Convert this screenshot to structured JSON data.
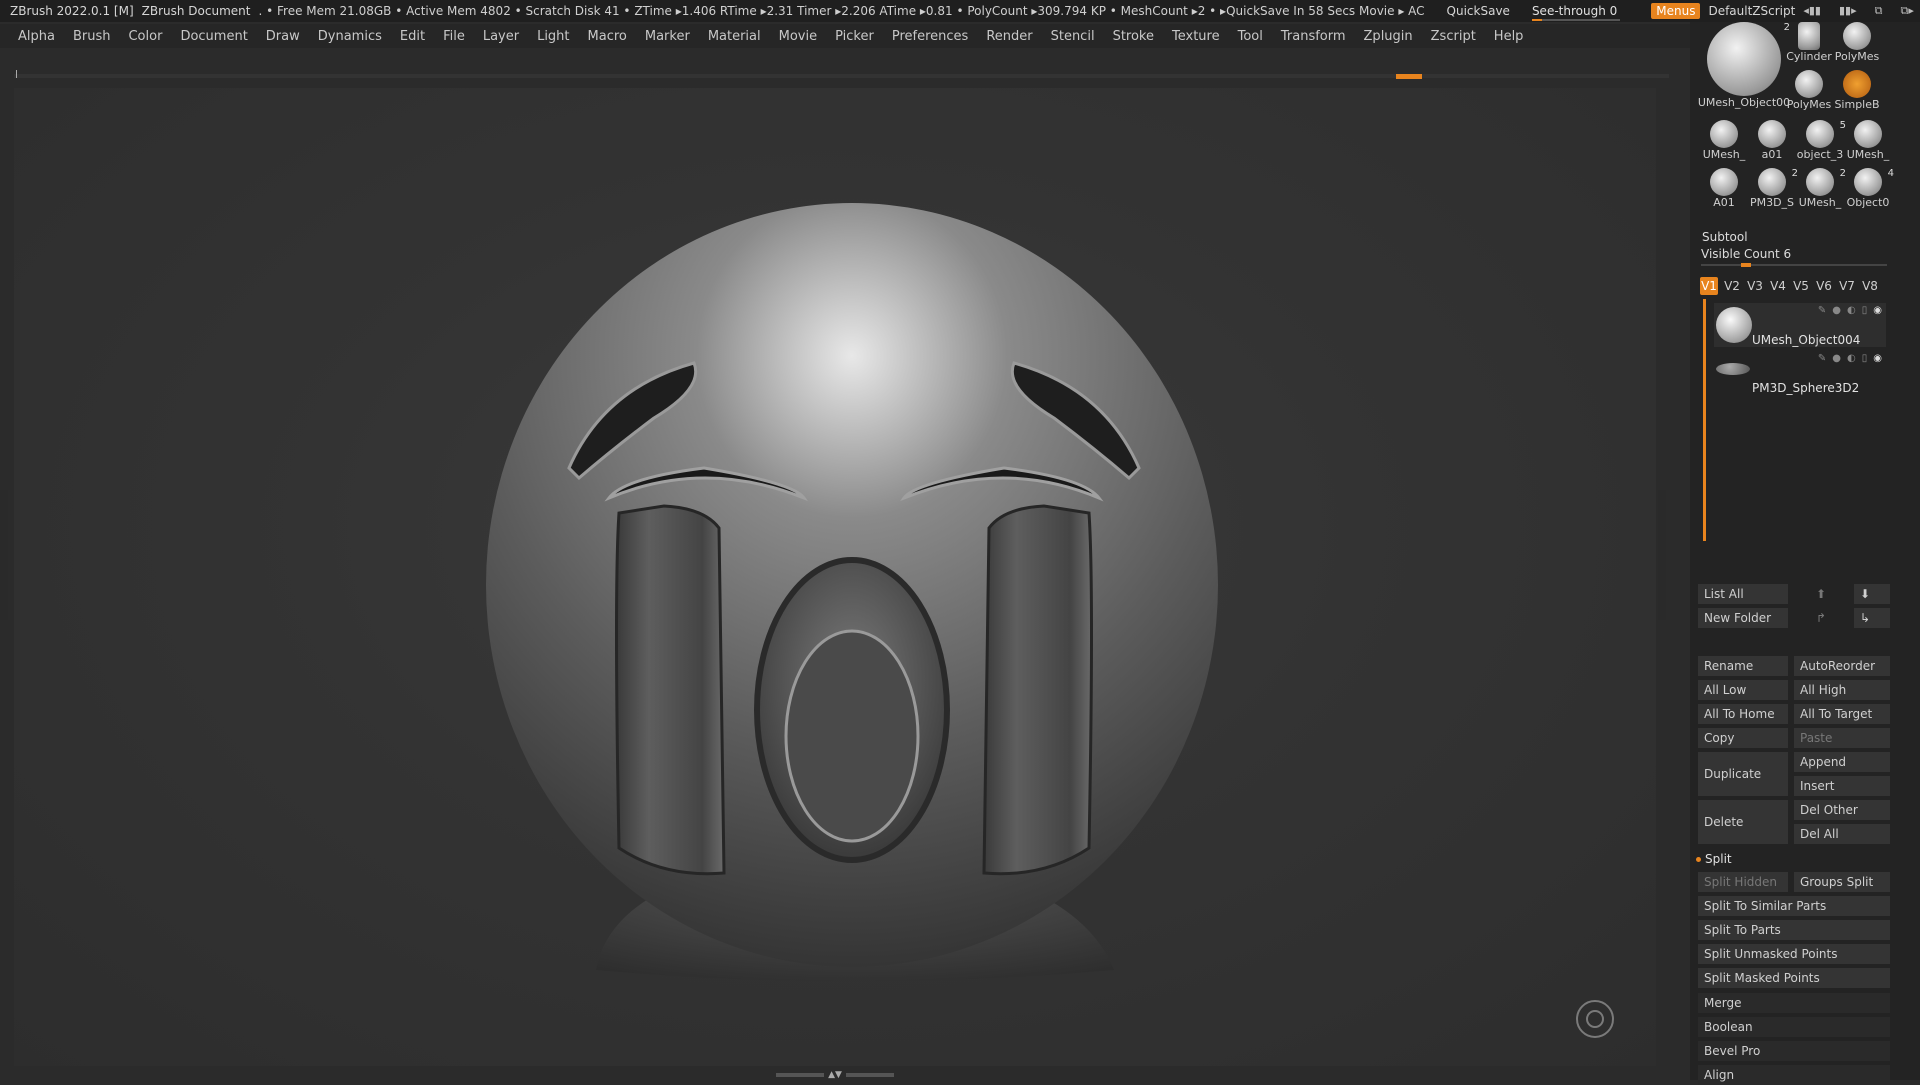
{
  "titlebar": {
    "app": "ZBrush 2022.0.1 [M]",
    "document": "ZBrush Document",
    "stats": ". • Free Mem 21.08GB • Active Mem 4802 • Scratch Disk 41 • ZTime ▸1.406 RTime ▸2.31 Timer ▸2.206 ATime ▸0.81 • PolyCount ▸309.794 KP • MeshCount ▸2 • ▸QuickSave In 58 Secs Movie ▸ AC",
    "quicksave": "QuickSave",
    "seethrough": "See-through   0",
    "menus": "Menus",
    "script": "DefaultZScript"
  },
  "menubar": [
    "Alpha",
    "Brush",
    "Color",
    "Document",
    "Draw",
    "Dynamics",
    "Edit",
    "File",
    "Layer",
    "Light",
    "Macro",
    "Marker",
    "Material",
    "Movie",
    "Picker",
    "Preferences",
    "Render",
    "Stencil",
    "Stroke",
    "Texture",
    "Tool",
    "Transform",
    "Zplugin",
    "Zscript",
    "Help"
  ],
  "tool_thumbnails": [
    {
      "label": "UMesh_Object00",
      "count": "2"
    },
    {
      "label": "Cylinder"
    },
    {
      "label": "PolyMes"
    },
    {
      "label": "PolyMes"
    },
    {
      "label": "SimpleB"
    },
    {
      "label": "UMesh_"
    },
    {
      "label": "a01"
    },
    {
      "label": "object_3",
      "count": "5"
    },
    {
      "label": "UMesh_"
    },
    {
      "label": "A01"
    },
    {
      "label": "PM3D_S",
      "count": "2"
    },
    {
      "label": "UMesh_",
      "count": "2"
    },
    {
      "label": "Object0",
      "count": "4"
    }
  ],
  "subtool": {
    "title": "Subtool",
    "visible_count": "Visible Count 6",
    "tabs": [
      "V1",
      "V2",
      "V3",
      "V4",
      "V5",
      "V6",
      "V7",
      "V8"
    ],
    "items": [
      {
        "name": "UMesh_Object004"
      },
      {
        "name": "PM3D_Sphere3D2"
      }
    ],
    "list_all": "List All",
    "new_folder": "New Folder",
    "buttons": {
      "rename": "Rename",
      "autoreorder": "AutoReorder",
      "all_low": "All Low",
      "all_high": "All High",
      "all_to_home": "All To Home",
      "all_to_target": "All To Target",
      "copy": "Copy",
      "paste": "Paste",
      "duplicate": "Duplicate",
      "append": "Append",
      "insert": "Insert",
      "delete": "Delete",
      "del_other": "Del Other",
      "del_all": "Del All"
    },
    "split_title": "Split",
    "split": {
      "split_hidden": "Split Hidden",
      "groups_split": "Groups Split",
      "split_similar": "Split To Similar Parts",
      "split_parts": "Split To Parts",
      "split_unmasked": "Split Unmasked Points",
      "split_masked": "Split Masked Points"
    },
    "sections": {
      "merge": "Merge",
      "boolean": "Boolean",
      "bevel_pro": "Bevel Pro",
      "align": "Align"
    }
  }
}
